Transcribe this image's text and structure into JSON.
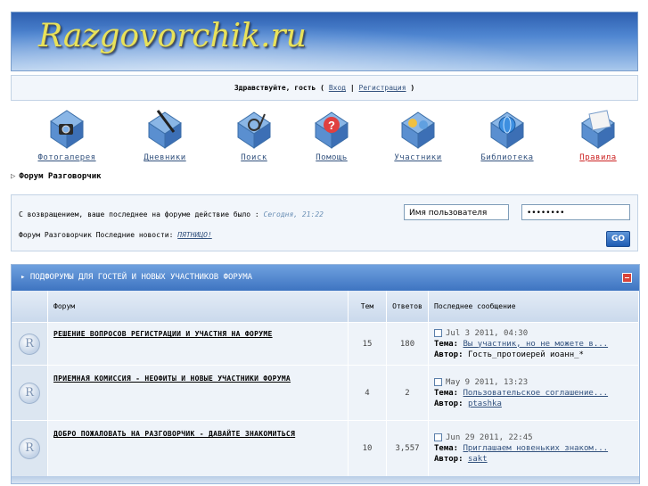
{
  "site": {
    "title": "Razgovorchik.ru"
  },
  "welcome": {
    "greeting": "Здравствуйте, гость ( ",
    "login": "Вход",
    "sep": " | ",
    "register": "Регистрация",
    "close": " )"
  },
  "nav": [
    {
      "label": "Фотогалерея",
      "icon": "camera-icon"
    },
    {
      "label": "Дневники",
      "icon": "pen-icon"
    },
    {
      "label": "Поиск",
      "icon": "search-icon"
    },
    {
      "label": "Помощь",
      "icon": "help-icon"
    },
    {
      "label": "Участники",
      "icon": "members-icon"
    },
    {
      "label": "Библиотека",
      "icon": "globe-icon"
    },
    {
      "label": "Правила",
      "icon": "notepad-icon"
    }
  ],
  "breadcrumb": "Форум Разговорчик",
  "login": {
    "welcome_back": "С возвращением, ваше последнее на форуме действие было : ",
    "last_action": "Сегодня, 21:22",
    "news_prefix": "Форум Разговорчик Последние новости: ",
    "news_link": "ПЯТНИЦО!",
    "username_placeholder": "Имя пользователя",
    "password_value": "••••••••",
    "go": "GO"
  },
  "forum": {
    "category_title": "ПОДФОРУМЫ ДЛЯ ГОСТЕЙ И НОВЫХ УЧАСТНИКОВ ФОРУМА",
    "columns": {
      "forum": "Форум",
      "topics": "Тем",
      "replies": "Ответов",
      "last_post": "Последнее сообщение"
    },
    "label_topic": "Тема:",
    "label_author": "Автор:",
    "rows": [
      {
        "name": "РЕШЕНИЕ ВОПРОСОВ РЕГИСТРАЦИИ И УЧАСТНЯ НА ФОРУМЕ",
        "topics": "15",
        "replies": "180",
        "date": "Jul 3 2011, 04:30",
        "topic": "Вы участник, но не можете в...",
        "author": "Гость_протоиерей иоанн_*"
      },
      {
        "name": "ПРИЕМНАЯ КОМИССИЯ - НЕОФИТЫ И НОВЫЕ УЧАСТНИКИ ФОРУМА",
        "topics": "4",
        "replies": "2",
        "date": "May 9 2011, 13:23",
        "topic": "Пользовательское соглашение...",
        "author": "ptashka"
      },
      {
        "name": "ДОБРО ПОЖАЛОВАТЬ НА РАЗГОВОРЧИК - ДАВАЙТЕ ЗНАКОМИТЬСЯ",
        "topics": "10",
        "replies": "3,557",
        "date": "Jun 29 2011, 22:45",
        "topic": "Приглашаем новеньких знаком...",
        "author": "sakt"
      }
    ]
  }
}
